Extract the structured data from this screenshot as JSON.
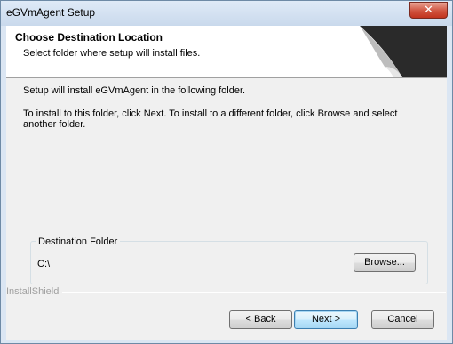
{
  "window": {
    "title": "eGVmAgent Setup",
    "close_glyph": "✕",
    "close_icon": "close-icon"
  },
  "header": {
    "title": "Choose Destination Location",
    "subtitle": "Select folder where setup will install files.",
    "graphic_icon": "page-curl-icon"
  },
  "body": {
    "line1": "Setup will install eGVmAgent in the following folder.",
    "line2a": "To install to this folder, click Next. To install to a different folder, click Browse and select",
    "line2b": "another folder."
  },
  "destination": {
    "group_label": "Destination Folder",
    "path": "C:\\",
    "browse_label": "Browse..."
  },
  "footer": {
    "brand": "InstallShield",
    "back_label": "< Back",
    "next_label": "Next >",
    "cancel_label": "Cancel"
  }
}
